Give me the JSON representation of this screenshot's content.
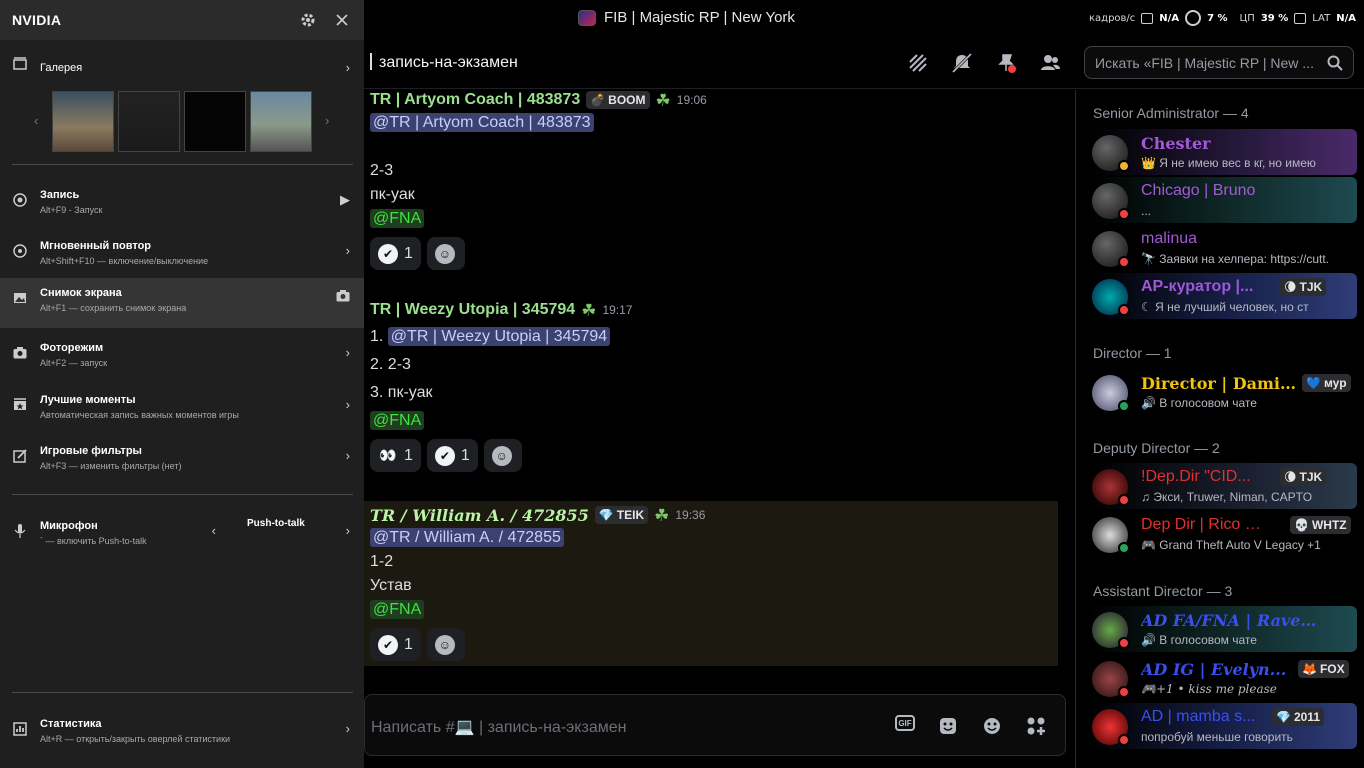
{
  "titlebar": {
    "server": "FIB | Majestic RP | New York",
    "overlay": {
      "fps_label": "кадров/с",
      "fps_value": "N/A",
      "gpu_value": "7 %",
      "cpu_label": "ЦП",
      "cpu_value": "39 %",
      "lat_label": "LAT",
      "lat_value": "N/A"
    }
  },
  "channel": {
    "name": "запись-на-экзамен",
    "search_placeholder": "Искать «FIB | Majestic RP | New ...",
    "composer_placeholder": "Написать #💻 | запись-на-экзамен"
  },
  "messages": [
    {
      "author": "TR | Artyom Coach | 483873",
      "tag": "BOOM",
      "time": "19:06",
      "mention": "@TR | Artyom Coach | 483873",
      "lines": [
        "2-3",
        "пк-уак"
      ],
      "role_mention": "@FNA",
      "reactions": [
        {
          "emoji": "check",
          "count": "1"
        }
      ]
    },
    {
      "author": "TR | Weezy Utopia | 345794",
      "time": "19:17",
      "line1_prefix": "1. ",
      "mention": "@TR | Weezy Utopia | 345794",
      "lines": [
        "2. 2-3",
        "3. пк-уак"
      ],
      "role_mention": "@FNA",
      "reactions": [
        {
          "emoji": "eyes",
          "count": "1"
        },
        {
          "emoji": "check",
          "count": "1"
        }
      ]
    },
    {
      "author": "TR / William A. / 472855",
      "tag": "TEIK",
      "time": "19:36",
      "mention": "@TR / William A. / 472855",
      "lines": [
        "1-2",
        "Устав"
      ],
      "role_mention": "@FNA",
      "reactions": [
        {
          "emoji": "check",
          "count": "1"
        }
      ]
    }
  ],
  "members": {
    "groups": [
      {
        "title": "Senior Administrator — 4"
      },
      {
        "title": "Director — 1"
      },
      {
        "title": "Deputy Director — 2"
      },
      {
        "title": "Assistant Director — 3"
      }
    ],
    "list": [
      {
        "name": "Chester",
        "status": "👑 Я не имею вес в кг, но имею",
        "color": "#a45ad6",
        "tag": ""
      },
      {
        "name": "Chicago | Bruno",
        "status": "...",
        "color": "#a45ad6",
        "tag": ""
      },
      {
        "name": "malinua",
        "status": "🔭 Заявки на хелпера: https://cutt.",
        "color": "#a45ad6",
        "tag": ""
      },
      {
        "name": "AP-куратор |...",
        "status": "☾ Я не лучший человек, но ст",
        "color": "#9b59d6",
        "tag": "TJK"
      },
      {
        "name": "Director | Damik...",
        "status": "🔊 В голосовом чате",
        "color": "#f1c40f",
        "tag": "мур"
      },
      {
        "name": "!Dep.Dir \"CID...",
        "status": "♫ Экси, Truwer, Niman, CAPTO",
        "color": "#e0302f",
        "tag": "TJK"
      },
      {
        "name": "Dep Dir | Rico D |...",
        "status": "🎮 Grand Theft Auto V Legacy +1",
        "color": "#e0302f",
        "tag": "WHTZ"
      },
      {
        "name": "AD FA/FNA | Raven...",
        "status": "🔊 В голосовом чате",
        "color": "#3a4ff0",
        "tag": ""
      },
      {
        "name": "AD IG | Evelyn...",
        "status": "🎮+1 • kiss me please",
        "color": "#3a4ff0",
        "tag": "FOX"
      },
      {
        "name": "AD | mamba s...",
        "status": "попробуй меньше говорить",
        "color": "#3a4ff0",
        "tag": "2011"
      }
    ]
  },
  "nvidia": {
    "brand": "NVIDIA",
    "gallery": "Галерея",
    "items": [
      {
        "title": "Запись",
        "sub": "Alt+F9 - Запуск"
      },
      {
        "title": "Мгновенный повтор",
        "sub": "Alt+Shift+F10 — включение/выключение"
      },
      {
        "title": "Снимок экрана",
        "sub": "Alt+F1 — сохранить снимок экрана"
      },
      {
        "title": "Фоторежим",
        "sub": "Alt+F2 — запуск"
      },
      {
        "title": "Лучшие моменты",
        "sub": "Автоматическая запись важных моментов игры"
      },
      {
        "title": "Игровые фильтры",
        "sub": "Alt+F3 — изменить фильтры (нет)"
      },
      {
        "title": "Микрофон",
        "sub": "` — включить Push-to-talk"
      },
      {
        "title": "Статистика",
        "sub": "Alt+R — открыть/закрыть оверлей статистики"
      }
    ],
    "mic_mode": "Push-to-talk"
  }
}
